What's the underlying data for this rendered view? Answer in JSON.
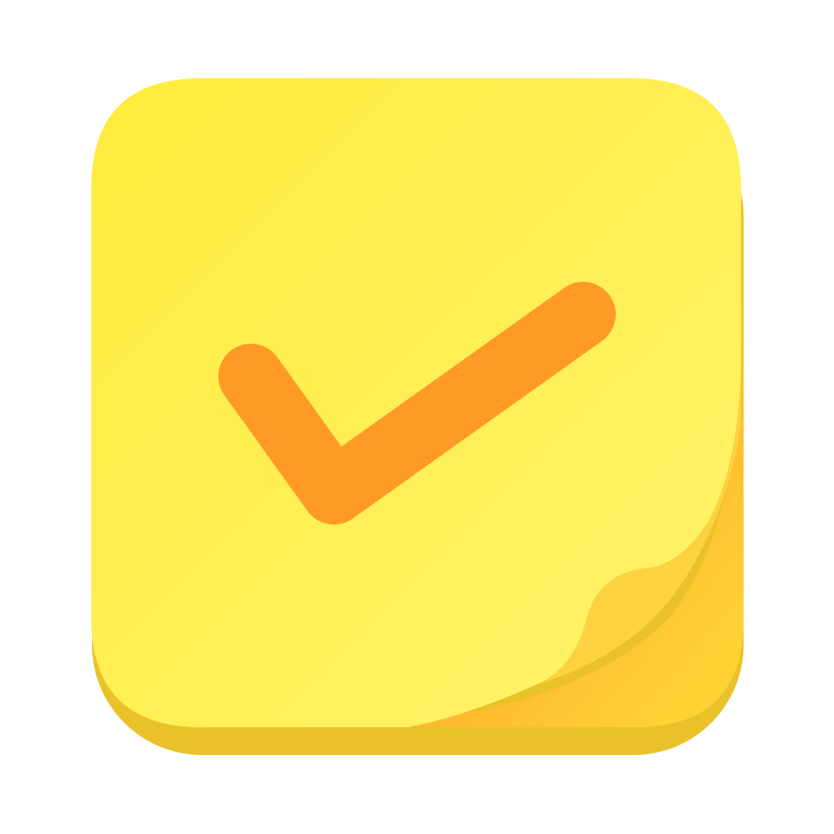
{
  "icon": {
    "name": "sticky-note-checkmark-app-icon",
    "depicts": [
      "sticky-note",
      "checkmark",
      "curled-corner"
    ]
  },
  "colors": {
    "background": "#ffffff",
    "note_top_light": "#FFF36E",
    "note_top_dark": "#FFEB3B",
    "note_base_shadow": "#E9C22A",
    "curl_light": "#FFE066",
    "curl_dark": "#FFB52E",
    "check": "#FF9A26"
  }
}
